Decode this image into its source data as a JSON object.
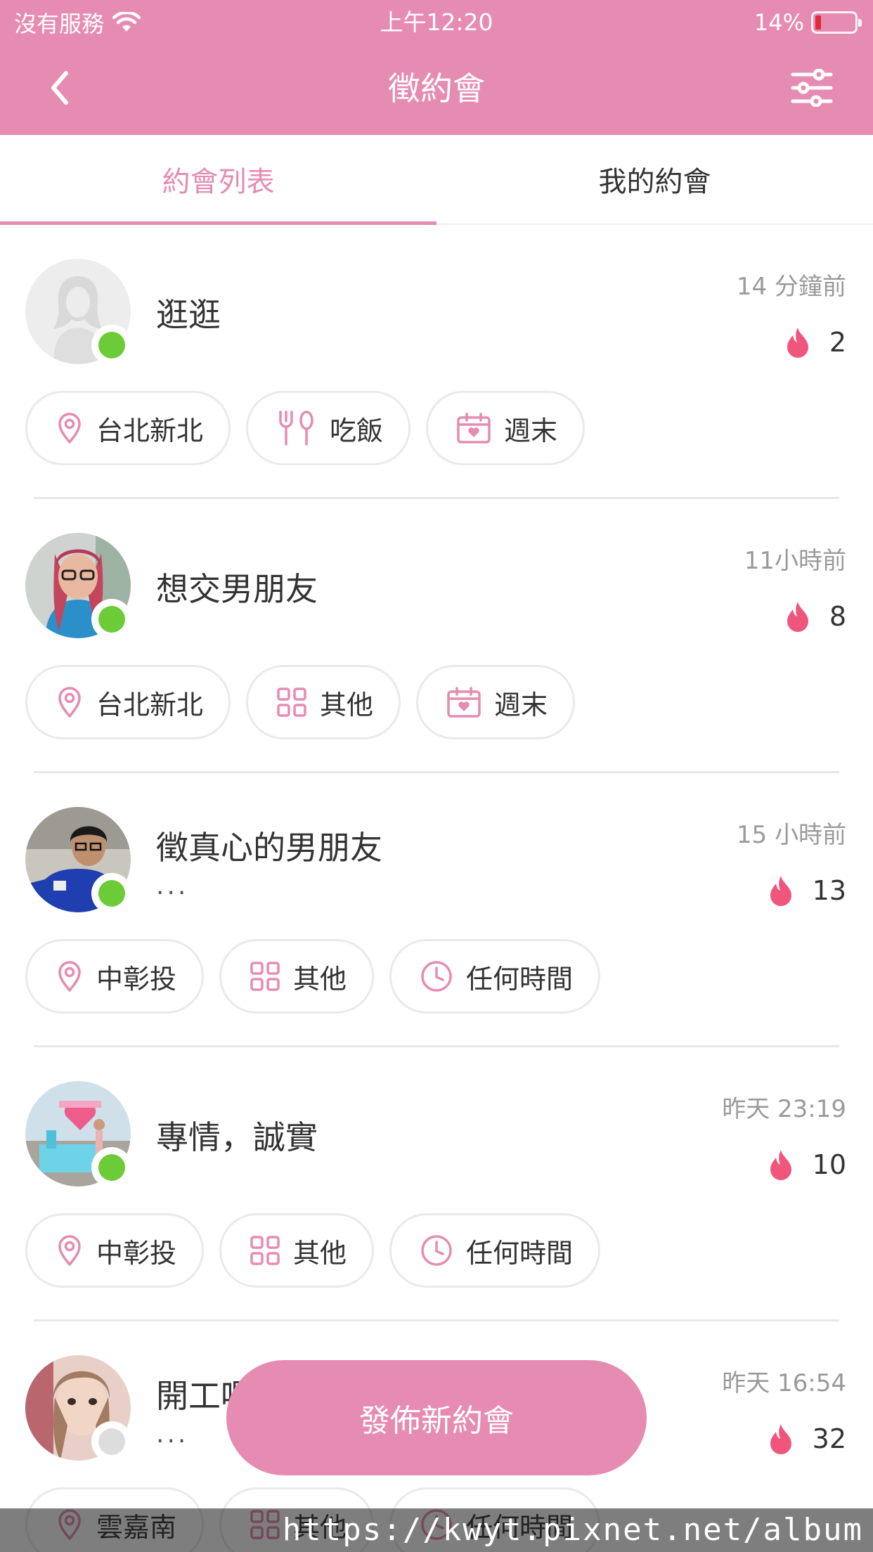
{
  "status_bar": {
    "carrier": "沒有服務",
    "time": "上午12:20",
    "battery": "14%"
  },
  "nav": {
    "title": "徵約會",
    "back_icon": "chevron-left-icon",
    "filter_icon": "sliders-icon"
  },
  "tabs": [
    {
      "label": "約會列表",
      "active": true
    },
    {
      "label": "我的約會",
      "active": false
    }
  ],
  "dates": [
    {
      "title": "逛逛",
      "subtitle": "",
      "time": "14 分鐘前",
      "heat": "2",
      "online": true,
      "avatar": "placeholder-silhouette",
      "tags": [
        {
          "icon": "location-icon",
          "label": "台北新北"
        },
        {
          "icon": "utensils-icon",
          "label": "吃飯"
        },
        {
          "icon": "calendar-icon",
          "label": "週末"
        }
      ]
    },
    {
      "title": "想交男朋友",
      "subtitle": "",
      "time": "11小時前",
      "heat": "8",
      "online": true,
      "avatar": "photo",
      "tags": [
        {
          "icon": "location-icon",
          "label": "台北新北"
        },
        {
          "icon": "grid-icon",
          "label": "其他"
        },
        {
          "icon": "calendar-icon",
          "label": "週末"
        }
      ]
    },
    {
      "title": "徵真心的男朋友",
      "subtitle": "...",
      "time": "15 小時前",
      "heat": "13",
      "online": true,
      "avatar": "photo",
      "tags": [
        {
          "icon": "location-icon",
          "label": "中彰投"
        },
        {
          "icon": "grid-icon",
          "label": "其他"
        },
        {
          "icon": "clock-icon",
          "label": "任何時間"
        }
      ]
    },
    {
      "title": "專情，誠實",
      "subtitle": "",
      "time": "昨天 23:19",
      "heat": "10",
      "online": true,
      "avatar": "photo",
      "tags": [
        {
          "icon": "location-icon",
          "label": "中彰投"
        },
        {
          "icon": "grid-icon",
          "label": "其他"
        },
        {
          "icon": "clock-icon",
          "label": "任何時間"
        }
      ]
    },
    {
      "title": "開工喔",
      "subtitle": "...",
      "time": "昨天 16:54",
      "heat": "32",
      "online": false,
      "avatar": "photo",
      "tags": [
        {
          "icon": "location-icon",
          "label": "雲嘉南"
        },
        {
          "icon": "grid-icon",
          "label": "其他"
        },
        {
          "icon": "clock-icon",
          "label": "任何時間"
        }
      ]
    }
  ],
  "publish_button": "發佈新約會",
  "watermark": "https://kwyt.pixnet.net/album",
  "colors": {
    "brand": "#e68bb2",
    "online": "#6ccc38",
    "offline": "#dddddd",
    "flame": "#f0567c"
  }
}
